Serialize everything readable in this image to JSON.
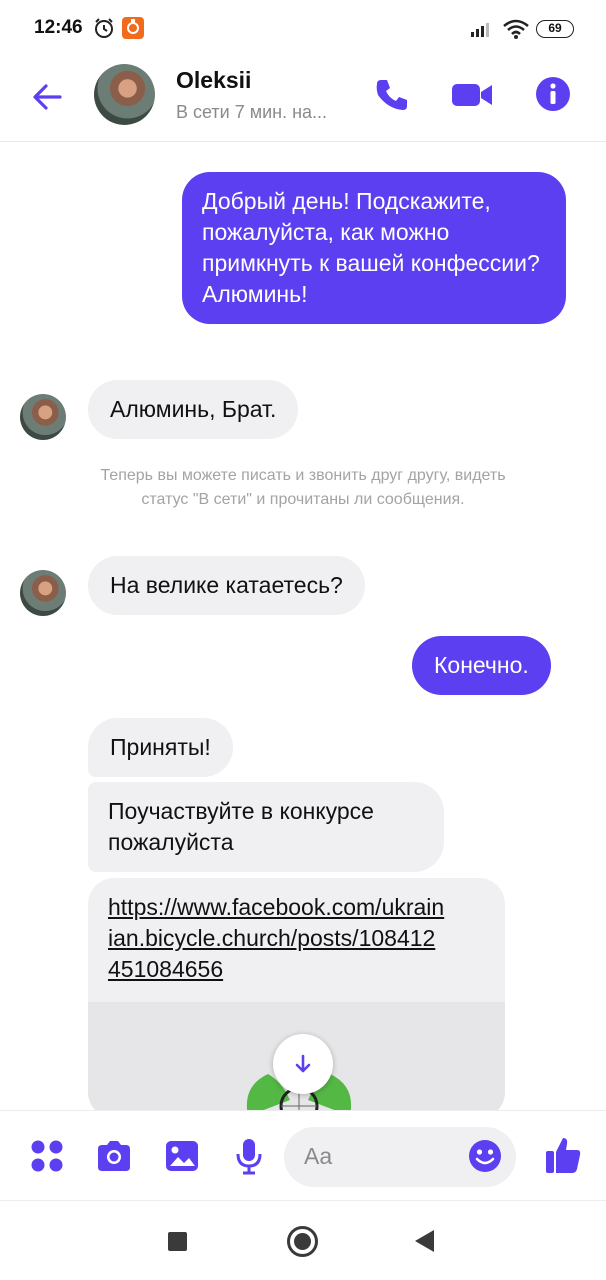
{
  "status_bar": {
    "time": "12:46",
    "battery": "69",
    "icons": [
      "alarm-icon",
      "app-notification-icon",
      "signal-icon",
      "wifi-icon",
      "battery-icon"
    ]
  },
  "header": {
    "name": "Oleksii",
    "status": "В сети 7 мин. на...",
    "icons": [
      "back-arrow-icon",
      "phone-icon",
      "video-camera-icon",
      "info-icon"
    ],
    "accent_color": "#5b3ff0"
  },
  "messages": [
    {
      "direction": "outgoing",
      "text": "Добрый день! Подскажите, пожалуйста, как можно примкнуть к вашей конфессии? Алюминь!"
    },
    {
      "direction": "incoming",
      "text": "Алюминь, Брат."
    },
    {
      "direction": "incoming",
      "text": "На велике катаетесь?"
    },
    {
      "direction": "outgoing",
      "text": "Конечно."
    },
    {
      "direction": "incoming",
      "text": "Приняты!"
    },
    {
      "direction": "incoming",
      "text": "Поучаствуйте в конкурсе пожалуйста"
    },
    {
      "direction": "incoming",
      "text": "https://www.facebook.com/ukrainian.bicycle.church/posts/108412451084656",
      "is_link": true
    }
  ],
  "system_note": "Теперь вы можете писать и звонить друг другу, видеть статус \"В сети\" и прочитаны ли сообщения.",
  "colors": {
    "outgoing_bubble": "#5b3ff0",
    "incoming_bubble": "#f0f0f2",
    "system_text": "#a3a3a8"
  },
  "composer": {
    "placeholder": "Aa",
    "icons": [
      "apps-icon",
      "camera-icon",
      "gallery-icon",
      "microphone-icon",
      "emoji-icon",
      "thumbs-up-icon"
    ]
  },
  "nav_bar": {
    "icons": [
      "recents-square-icon",
      "home-circle-icon",
      "back-triangle-icon"
    ]
  }
}
